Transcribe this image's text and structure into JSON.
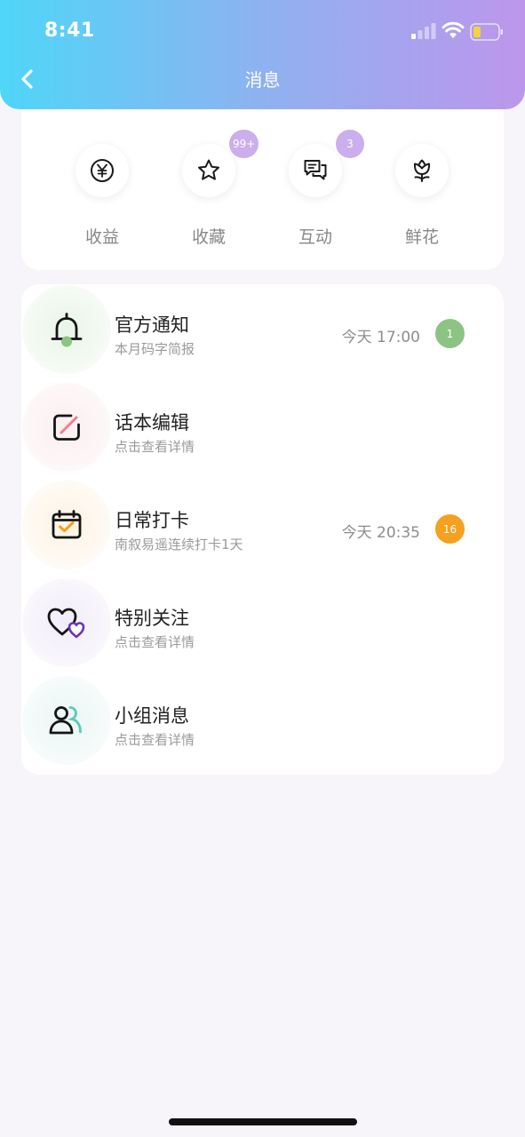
{
  "status_bar": {
    "time": "8:41"
  },
  "header": {
    "title": "消息"
  },
  "quick_actions": [
    {
      "label": "收益",
      "icon": "yen-icon",
      "badge": ""
    },
    {
      "label": "收藏",
      "icon": "star-icon",
      "badge": "99+"
    },
    {
      "label": "互动",
      "icon": "chat-icon",
      "badge": "3"
    },
    {
      "label": "鲜花",
      "icon": "flower-icon",
      "badge": ""
    }
  ],
  "messages": [
    {
      "title": "官方通知",
      "subtitle": "本月码字简报",
      "time": "今天 17:00",
      "badge": "1",
      "icon": "bell-icon",
      "icon_bg": "#eef7ee",
      "badge_color": "#8cc483"
    },
    {
      "title": "话本编辑",
      "subtitle": "点击查看详情",
      "time": "",
      "badge": "",
      "icon": "edit-icon",
      "icon_bg": "#fdf2f3",
      "badge_color": ""
    },
    {
      "title": "日常打卡",
      "subtitle": "南叙易遥连续打卡1天",
      "time": "今天 20:35",
      "badge": "16",
      "icon": "calendar-check-icon",
      "icon_bg": "#fdf7ee",
      "badge_color": "#f5a01f"
    },
    {
      "title": "特别关注",
      "subtitle": "点击查看详情",
      "time": "",
      "badge": "",
      "icon": "hearts-icon",
      "icon_bg": "#f5f1fb",
      "badge_color": ""
    },
    {
      "title": "小组消息",
      "subtitle": "点击查看详情",
      "time": "",
      "badge": "",
      "icon": "group-icon",
      "icon_bg": "#eff8f7",
      "badge_color": ""
    }
  ],
  "colors": {
    "header_gradient_start": "#4fd6f8",
    "header_gradient_end": "#bd96ec",
    "badge_purple": "#cbaeec",
    "badge_green": "#8cc483",
    "badge_orange": "#f5a01f",
    "page_background": "#f7f5f9"
  }
}
